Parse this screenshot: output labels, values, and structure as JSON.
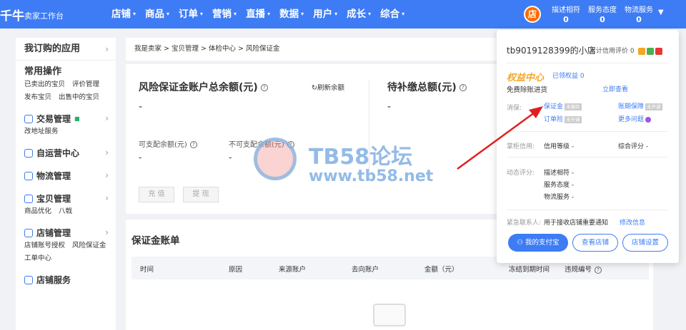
{
  "topbar": {
    "brand": "千牛",
    "brand_sub": "卖家工作台",
    "nav": [
      "店铺",
      "商品",
      "订单",
      "营销",
      "直播",
      "数据",
      "用户",
      "成长",
      "综合"
    ],
    "avatar_text": "店",
    "stats": [
      {
        "label": "描述相符",
        "value": "0"
      },
      {
        "label": "服务态度",
        "value": "0"
      },
      {
        "label": "物流服务",
        "value": "0"
      }
    ],
    "accent": "#3d7cf5"
  },
  "sidebar": {
    "title": "我订购的应用",
    "common_title": "常用操作",
    "common_links": [
      "已卖出的宝贝",
      "评价管理",
      "发布宝贝",
      "出售中的宝贝"
    ],
    "sections": [
      {
        "title": "交易管理",
        "links": [
          "改地址服务"
        ]
      },
      {
        "title": "自运营中心",
        "links": []
      },
      {
        "title": "物流管理",
        "links": []
      },
      {
        "title": "宝贝管理",
        "links": [
          "商品优化",
          "八戟"
        ]
      },
      {
        "title": "店铺管理",
        "links": [
          "店铺账号授权",
          "风险保证金",
          "工单中心"
        ]
      },
      {
        "title": "店铺服务",
        "links": []
      }
    ]
  },
  "breadcrumb": "我是卖家 > 宝贝管理 > 体检中心 > 风险保证金",
  "balance": {
    "title": "风险保证金账户总余额(元)",
    "help_icon": "?",
    "refresh": "刷新余额",
    "value": "-",
    "distributable_label": "可支配余额(元)",
    "distributable_value": "-",
    "non_distributable_label": "不可支配余额(元)",
    "non_distributable_value": "-",
    "recharge": "充 值",
    "withdraw": "提 现",
    "pending_title": "待补缴总额(元)",
    "pending_value": "-"
  },
  "ledger": {
    "title": "保证金账单",
    "columns": [
      "时间",
      "原因",
      "来源账户",
      "去向账户",
      "金额（元）",
      "冻结到期时间",
      "违规编号"
    ]
  },
  "watermark": {
    "line1": "TB58论坛",
    "line2": "www.tb58.net"
  },
  "popover": {
    "shop_name": "tb9019128399的小店",
    "credit_label": "累计信用评价",
    "credit_value": "0",
    "rights_title": "权益中心",
    "rights_link": "已领权益 0",
    "free_text": "免费除账进货",
    "view_now": "立即查看",
    "guarantee_label": "消保:",
    "guarantee_items": [
      {
        "label": "保证金",
        "tag": "未缴存"
      },
      {
        "label": "账期保障",
        "tag": "未开通"
      },
      {
        "label": "订单险",
        "tag": "未开通"
      },
      {
        "label": "更多问题"
      }
    ],
    "seller_credit_label": "掌柜信用:",
    "credit_level": "信用等级 -",
    "overall_score": "综合评分 -",
    "dynamic_label": "动态评分:",
    "dynamic_items": [
      "描述相符 -",
      "服务态度 -",
      "物流服务 -"
    ],
    "contact_label": "紧急联系人:",
    "contact_text": "用于接收店铺重要通知",
    "modify_info": "修改信息",
    "btn_alipay": "我的支付宝",
    "btn_view_shop": "查看店铺",
    "btn_shop_settings": "店铺设置"
  }
}
